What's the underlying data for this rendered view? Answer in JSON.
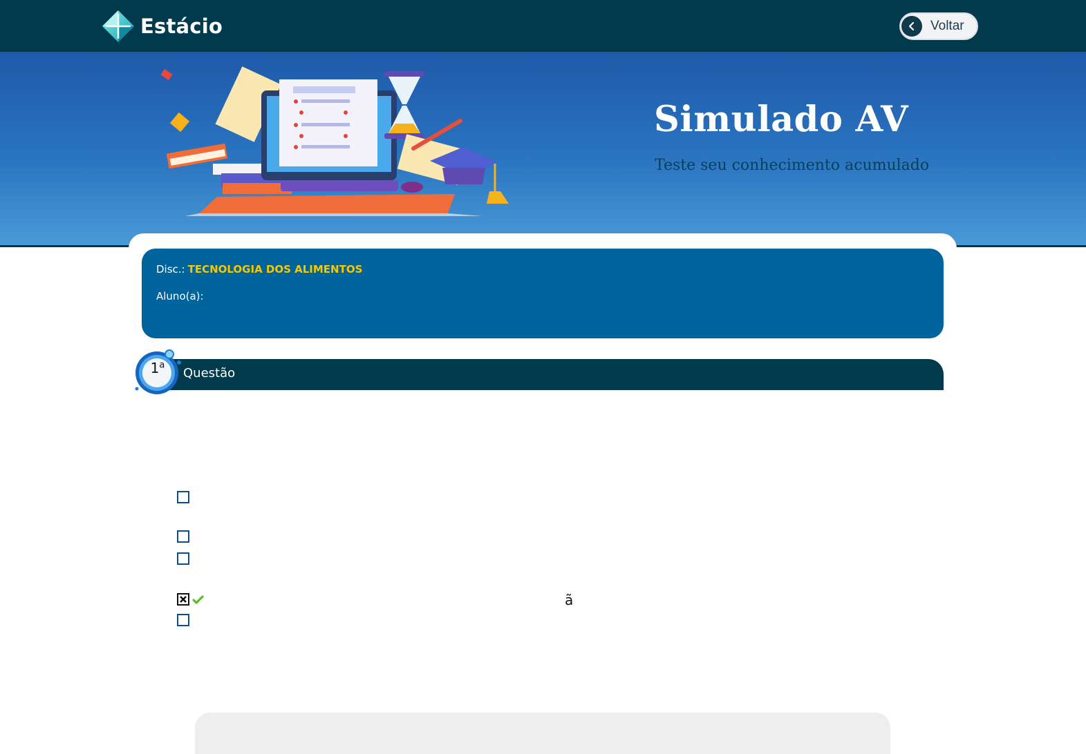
{
  "app": {
    "brand": "Estácio"
  },
  "header": {
    "back_label": "Voltar"
  },
  "hero": {
    "title": "Simulado AV",
    "subtitle": "Teste seu conhecimento acumulado"
  },
  "info": {
    "disc_label": "Disc.:",
    "disc_value": "TECNOLOGIA DOS ALIMENTOS",
    "student_label": "Aluno(a):"
  },
  "question": {
    "number": "1",
    "ordinal_suffix": "a",
    "label": "Questão",
    "options": [
      {
        "checked": false
      },
      {
        "checked": false
      },
      {
        "checked": false
      },
      {
        "checked": true,
        "correct": true
      },
      {
        "checked": false
      }
    ],
    "stray_text": "ã"
  },
  "colors": {
    "topbar": "#003a4c",
    "info_box": "#00649c",
    "disc_highlight": "#f6c800",
    "hero_gradient_top": "#1e5aa9",
    "hero_gradient_bottom": "#4a9ad6",
    "correct_check": "#5bbf21"
  }
}
